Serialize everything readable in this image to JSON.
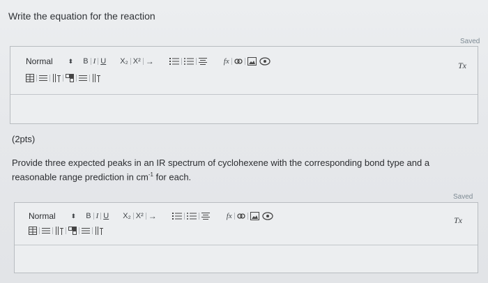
{
  "question1": {
    "prompt": "Write the equation for the reaction",
    "status": "Saved"
  },
  "question2": {
    "points": "(2pts)",
    "prompt_line1": "Provide three expected peaks in an IR spectrum of cyclohexene with the corresponding bond type and a",
    "prompt_line2_pre": "reasonable range prediction in cm",
    "prompt_line2_sup": "-1",
    "prompt_line2_post": " for each.",
    "status": "Saved"
  },
  "toolbar": {
    "format_value": "Normal",
    "format_caret": "⬍",
    "bold": "B",
    "italic": "I",
    "underline": "U",
    "subscript": "X₂",
    "superscript": "X²",
    "arrow": "→",
    "function": "fx",
    "clear_formatting": "Tx"
  }
}
